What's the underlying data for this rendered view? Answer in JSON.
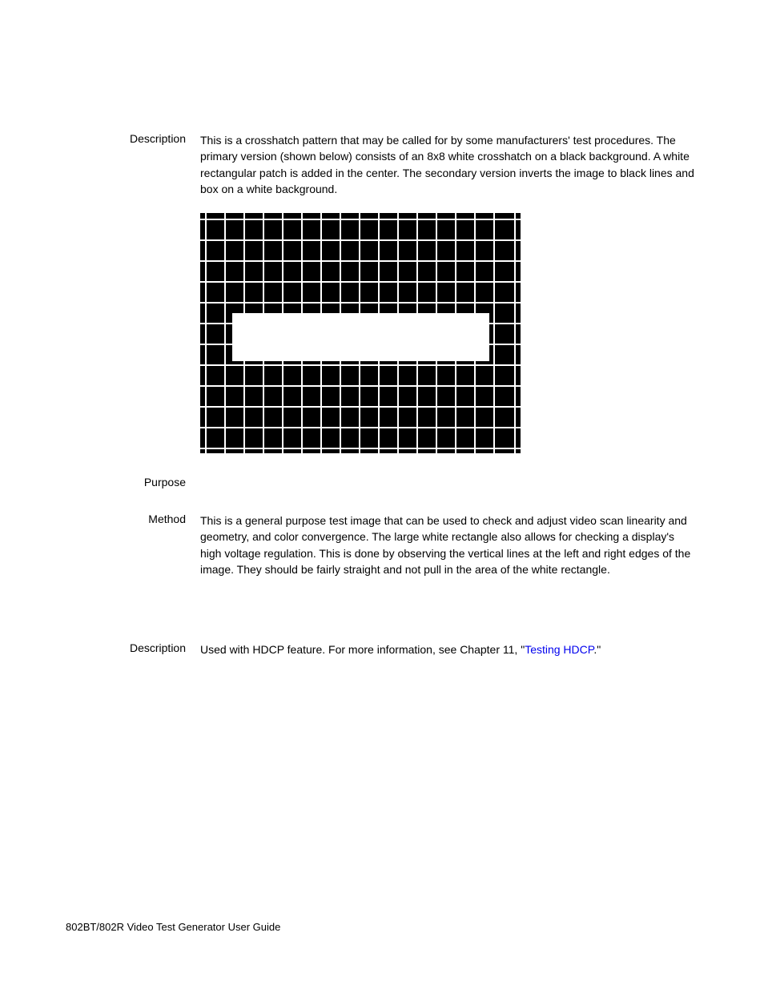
{
  "sections": {
    "description1": {
      "label": "Description",
      "text": "This is a crosshatch pattern that may be called for by some manufacturers' test procedures. The primary version (shown below) consists of an 8x8 white crosshatch on a black background. A white rectangular patch is added in the center. The secondary version inverts the image to black lines and box on a white background."
    },
    "purpose": {
      "label": "Purpose",
      "text": ""
    },
    "method": {
      "label": "Method",
      "text": "This is a general purpose test image that can be used to check and adjust video scan linearity and geometry, and color convergence. The large white rectangle also allows for checking a display's high voltage regulation. This is done by observing the vertical lines at the left and right edges of the image. They should be fairly straight and not pull in the area of the white rectangle."
    },
    "description2": {
      "label": "Description",
      "prefix": "Used with HDCP feature. For more information, see Chapter 11, \"",
      "link": "Testing HDCP",
      "suffix": ".\""
    }
  },
  "footer": "802BT/802R Video Test Generator User Guide"
}
